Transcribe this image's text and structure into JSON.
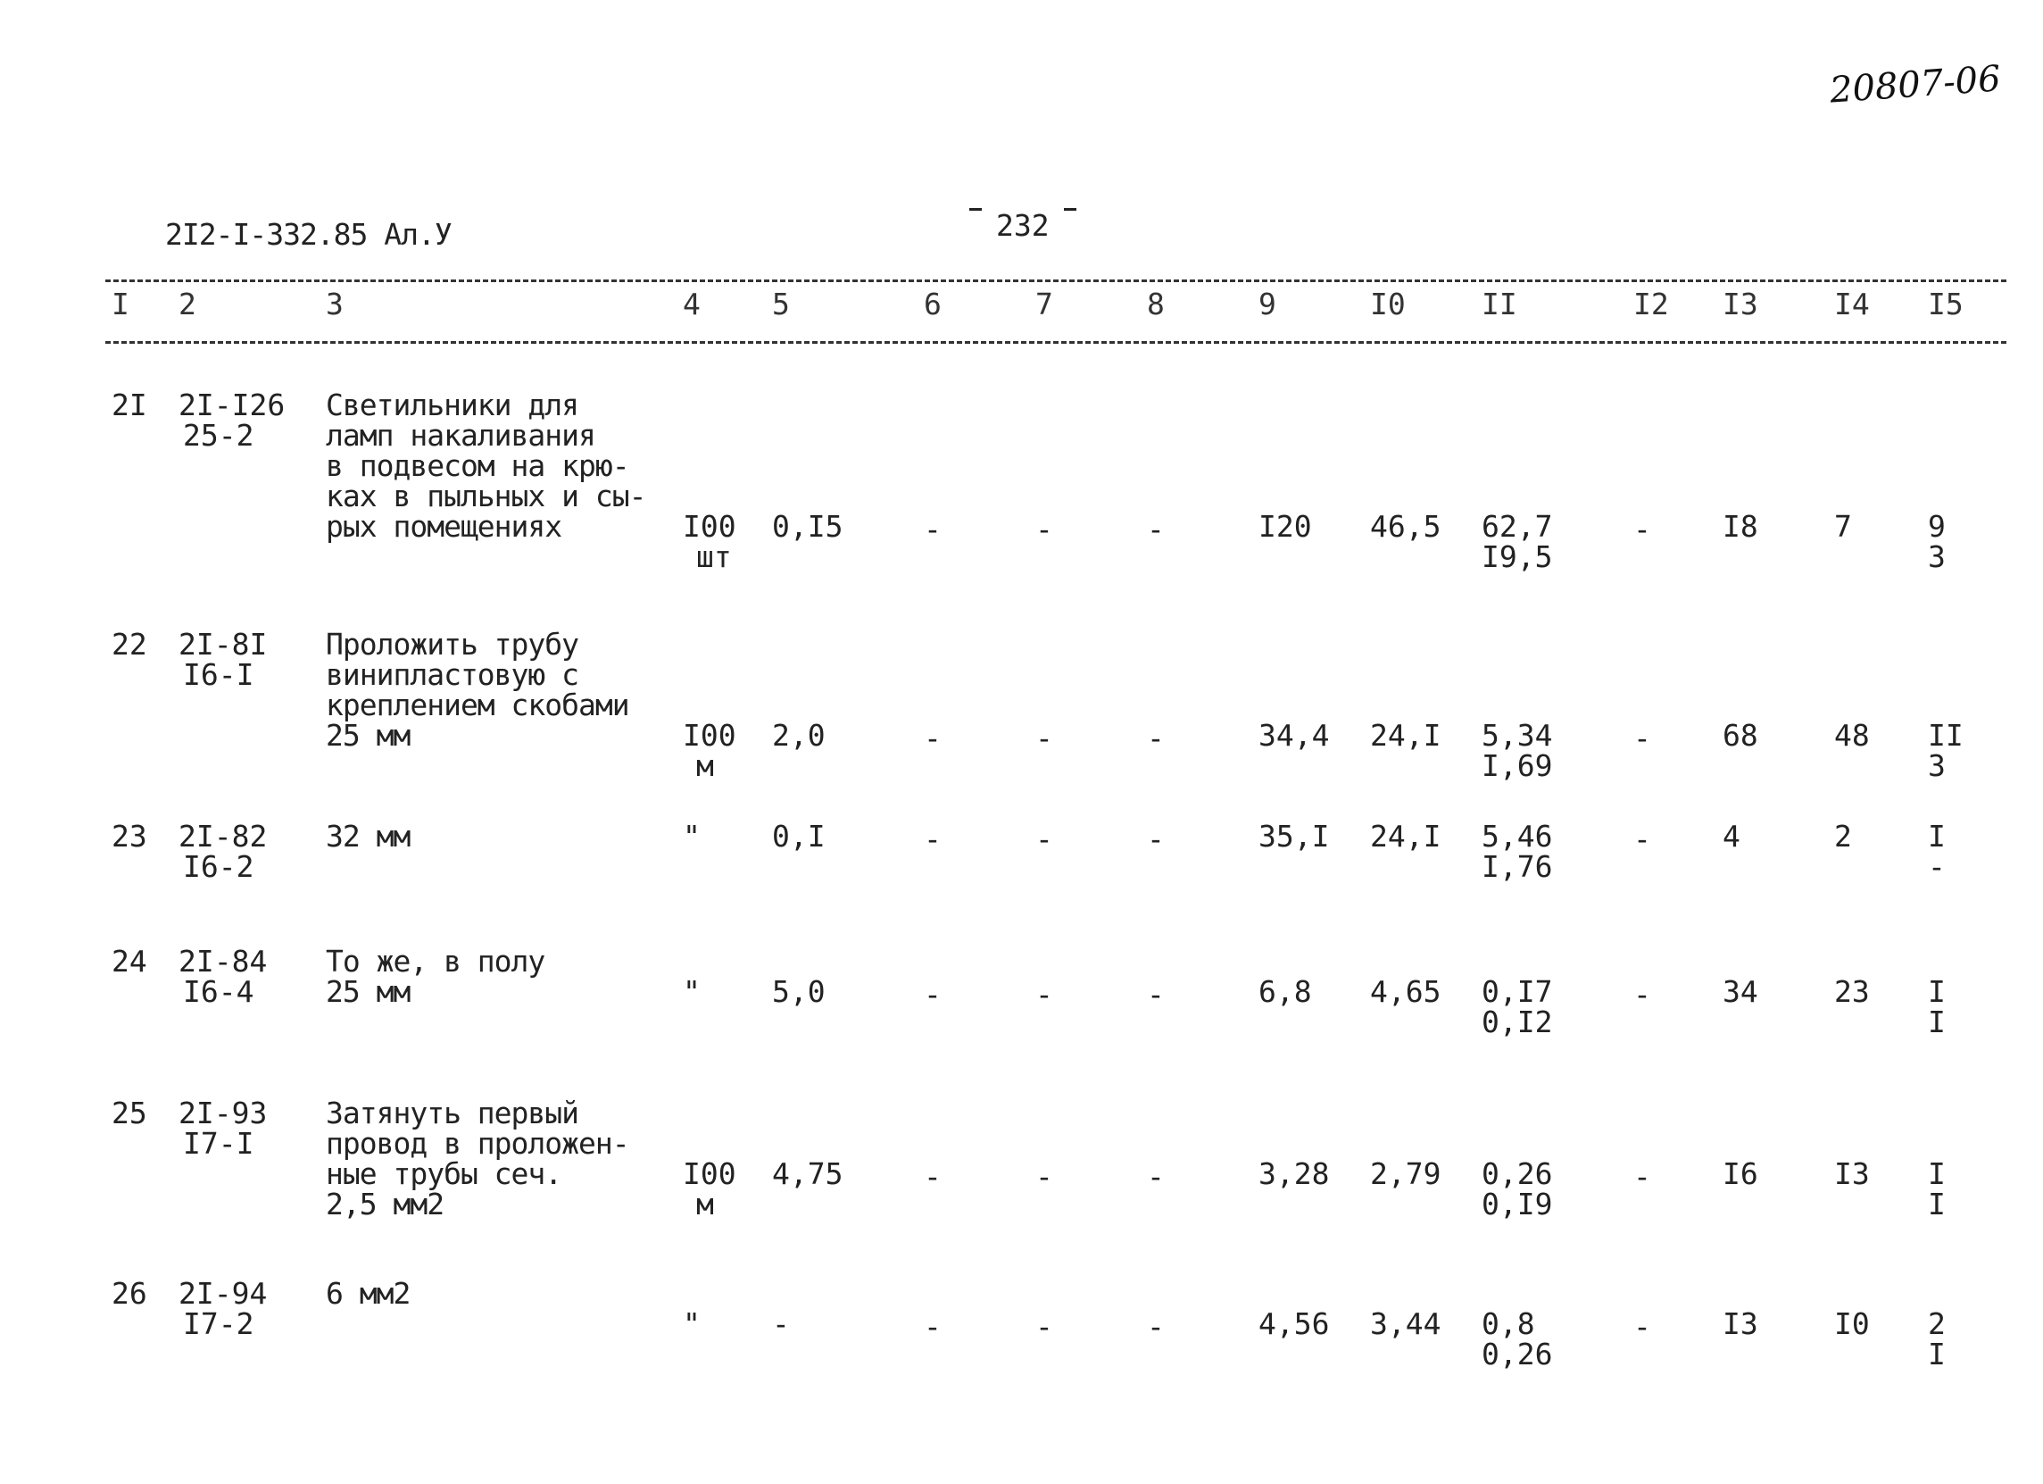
{
  "handwritten_number": "20807-06",
  "document_code": "2I2-I-332.85 Ал.У",
  "page_number": "232",
  "column_headers": [
    "I",
    "2",
    "3",
    "4",
    "5",
    "6",
    "7",
    "8",
    "9",
    "I0",
    "II",
    "I2",
    "I3",
    "I4",
    "I5"
  ],
  "rows": [
    {
      "num": "2I",
      "code": [
        "2I-I26",
        "25-2"
      ],
      "description": [
        "Светильники для",
        "ламп накаливания",
        "в подвесом на крю-",
        "ках в пыльных и сы-",
        "рых помещениях"
      ],
      "unit": [
        "I00",
        "шт"
      ],
      "qty": "0,I5",
      "c6": "-",
      "c7": "-",
      "c8": "-",
      "c9": "I20",
      "c10": "46,5",
      "c11": [
        "62,7",
        "I9,5"
      ],
      "c12": "-",
      "c13": "I8",
      "c14": "7",
      "c15": [
        "9",
        "3"
      ]
    },
    {
      "num": "22",
      "code": [
        "2I-8I",
        "I6-I"
      ],
      "description": [
        "Проложить трубу",
        "винипластовую с",
        "креплением скобами",
        "25 мм"
      ],
      "unit": [
        "I00",
        "м"
      ],
      "qty": "2,0",
      "c6": "-",
      "c7": "-",
      "c8": "-",
      "c9": "34,4",
      "c10": "24,I",
      "c11": [
        "5,34",
        "I,69"
      ],
      "c12": "-",
      "c13": "68",
      "c14": "48",
      "c15": [
        "II",
        "3"
      ]
    },
    {
      "num": "23",
      "code": [
        "2I-82",
        "I6-2"
      ],
      "description": [
        "32 мм"
      ],
      "unit": [
        "\"",
        ""
      ],
      "qty": "0,I",
      "c6": "-",
      "c7": "-",
      "c8": "-",
      "c9": "35,I",
      "c10": "24,I",
      "c11": [
        "5,46",
        "I,76"
      ],
      "c12": "-",
      "c13": "4",
      "c14": "2",
      "c15": [
        "I",
        "-"
      ]
    },
    {
      "num": "24",
      "code": [
        "2I-84",
        "I6-4"
      ],
      "description": [
        "То же, в полу",
        "25 мм"
      ],
      "unit": [
        "\"",
        ""
      ],
      "qty": "5,0",
      "c6": "-",
      "c7": "-",
      "c8": "-",
      "c9": "6,8",
      "c10": "4,65",
      "c11": [
        "0,I7",
        "0,I2"
      ],
      "c12": "-",
      "c13": "34",
      "c14": "23",
      "c15": [
        "I",
        "I"
      ]
    },
    {
      "num": "25",
      "code": [
        "2I-93",
        "I7-I"
      ],
      "description": [
        "Затянуть первый",
        "провод в проложен-",
        "ные трубы сеч.",
        "2,5 мм2"
      ],
      "unit": [
        "I00",
        "м"
      ],
      "qty": "4,75",
      "c6": "-",
      "c7": "-",
      "c8": "-",
      "c9": "3,28",
      "c10": "2,79",
      "c11": [
        "0,26",
        "0,I9"
      ],
      "c12": "-",
      "c13": "I6",
      "c14": "I3",
      "c15": [
        "I",
        "I"
      ]
    },
    {
      "num": "26",
      "code": [
        "2I-94",
        "I7-2"
      ],
      "description": [
        "6 мм2"
      ],
      "unit": [
        "\"",
        ""
      ],
      "qty": "-",
      "c6": "-",
      "c7": "-",
      "c8": "-",
      "c9": "4,56",
      "c10": "3,44",
      "c11": [
        "0,8",
        "0,26"
      ],
      "c12": "-",
      "c13": "I3",
      "c14": "I0",
      "c15": [
        "2",
        "I"
      ]
    }
  ]
}
